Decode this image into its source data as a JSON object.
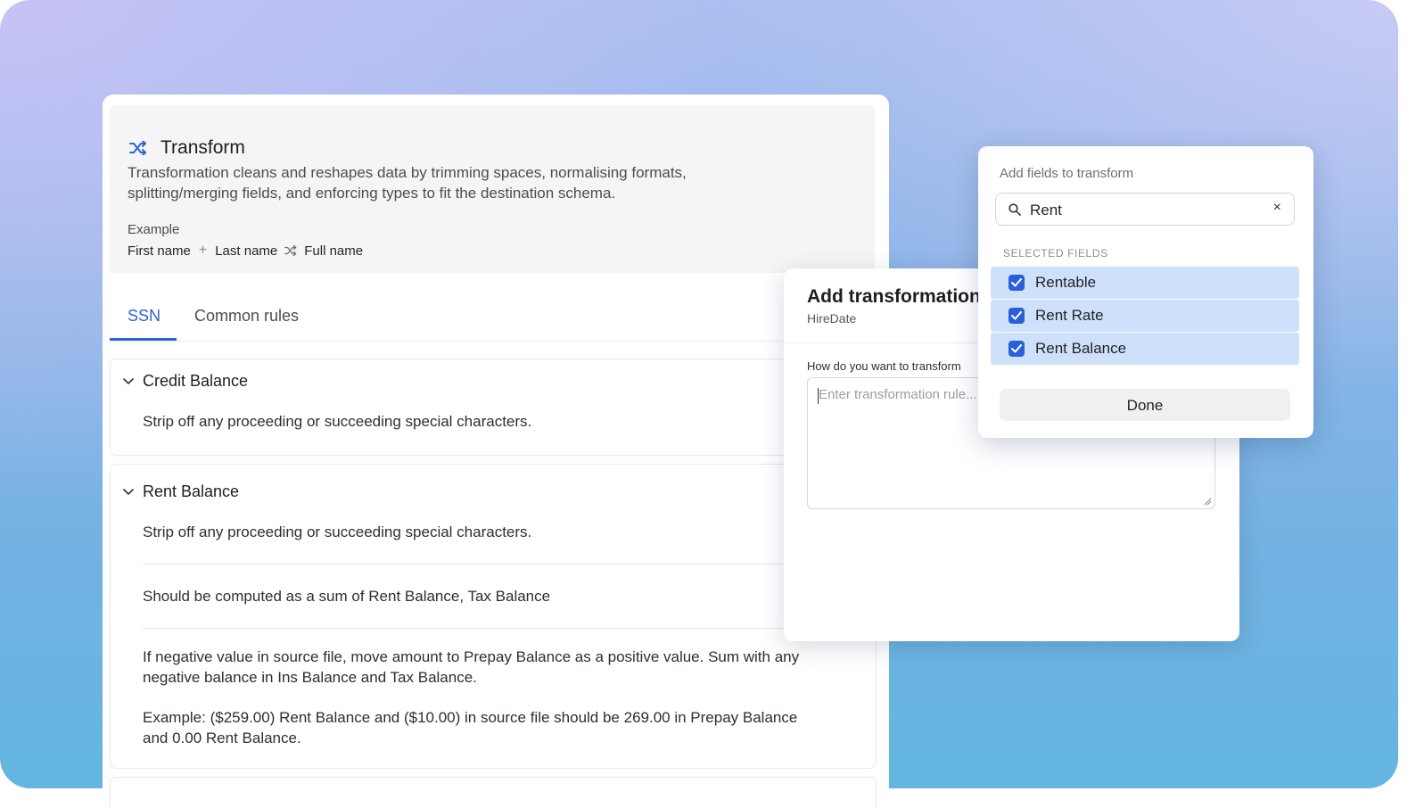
{
  "transform": {
    "title": "Transform",
    "description": "Transformation cleans and reshapes data by trimming spaces, normalising formats, splitting/merging fields, and enforcing types to fit the destination schema.",
    "example_label": "Example",
    "example": {
      "field1": "First name",
      "plus": "+",
      "field2": "Last name",
      "result": "Full name"
    }
  },
  "tabs": [
    {
      "label": "SSN",
      "active": true
    },
    {
      "label": "Common rules",
      "active": false
    }
  ],
  "rules": [
    {
      "title": "Credit Balance",
      "items": [
        "Strip off any proceeding or succeeding special characters."
      ]
    },
    {
      "title": "Rent Balance",
      "items": [
        "Strip off any proceeding or succeeding special characters.",
        "Should be computed as a sum of Rent Balance, Tax Balance",
        "If negative value in source file, move amount to Prepay Balance as a positive value. Sum with any negative balance in Ins Balance and Tax Balance.",
        "Example: ($259.00) Rent Balance and ($10.00) in source file should be 269.00 in Prepay Balance and 0.00 Rent Balance."
      ]
    }
  ],
  "add_transformation": {
    "title": "Add transformation",
    "field": "HireDate",
    "question": "How do you want to transform",
    "placeholder": "Enter transformation rule..."
  },
  "field_picker": {
    "title": "Add fields to transform",
    "search_value": "Rent",
    "clear_symbol": "×",
    "section_label": "SELECTED FIELDS",
    "options": [
      {
        "label": "Rentable",
        "checked": true
      },
      {
        "label": "Rent Rate",
        "checked": true
      },
      {
        "label": "Rent Balance",
        "checked": true
      }
    ],
    "done_label": "Done"
  },
  "colors": {
    "accent": "#2f62d8",
    "checkbox": "#2b5fd9",
    "selected_row": "#cfe0fb"
  }
}
